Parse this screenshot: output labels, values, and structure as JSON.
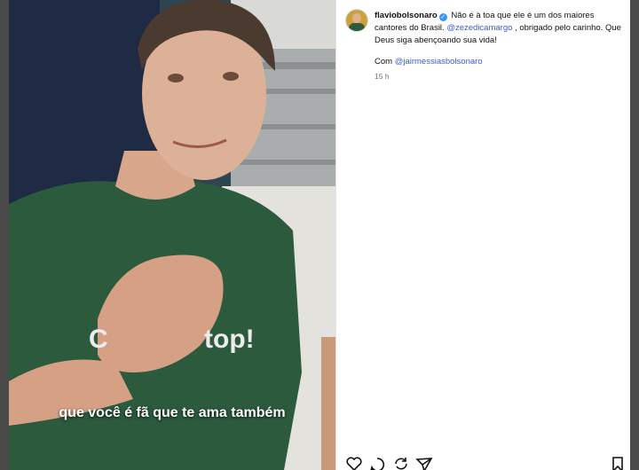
{
  "post": {
    "subtitle": "que você é fã que te ama também",
    "shirt_text": "top!",
    "username": "flaviobolsonaro",
    "caption_text": "Não é à toa que ele é um dos maiores cantores do Brasil.",
    "mention_1": "@zezedicamargo",
    "caption_text_2": ", obrigado pelo carinho. Que Deus siga abençoando sua vida!",
    "with_label": "Com",
    "mention_2": "@jairmessiasbolsonaro",
    "time": "15 h"
  },
  "icons": [
    "heart-icon",
    "comment-icon",
    "repost-icon",
    "share-icon",
    "bookmark-icon"
  ],
  "colors": {
    "verified": "#3897f0",
    "mention": "#3b5bdb",
    "shirt": "#2c5a3d"
  }
}
